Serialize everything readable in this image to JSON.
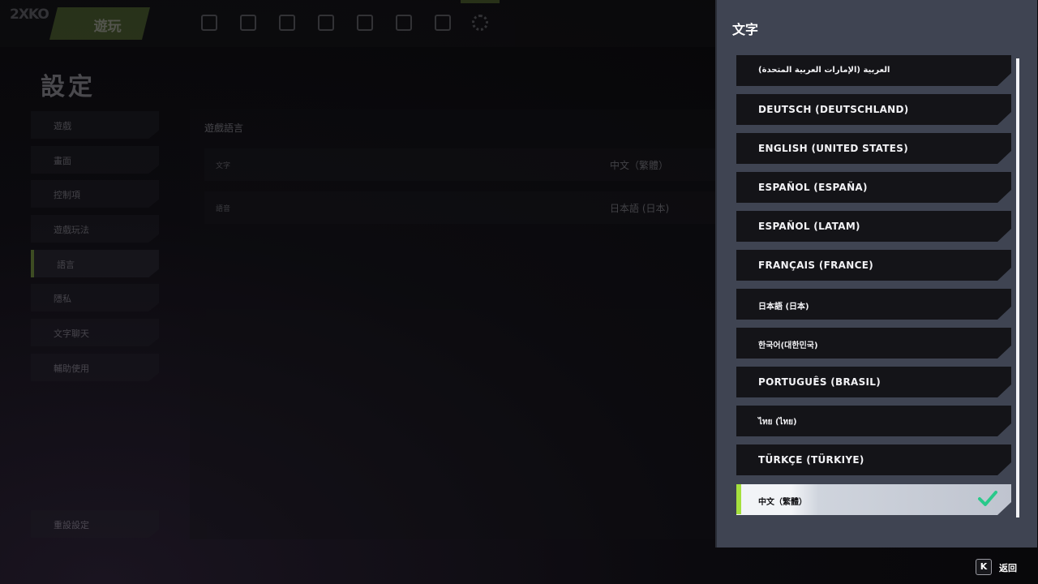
{
  "topbar": {
    "logo": "2XKO",
    "play_tab": "遊玩",
    "icons": [
      "store-icon",
      "bag-icon",
      "mail-icon",
      "collection-icon",
      "social-icon",
      "trophy-icon",
      "profile-icon",
      "calendar-icon",
      "gear-icon"
    ]
  },
  "settings_page": {
    "title": "設定",
    "sidebar": [
      {
        "label": "遊戲",
        "selected": false
      },
      {
        "label": "畫面",
        "selected": false
      },
      {
        "label": "控制項",
        "selected": false
      },
      {
        "label": "遊戲玩法",
        "selected": false
      },
      {
        "label": "語言",
        "selected": true
      },
      {
        "label": "隱私",
        "selected": false
      },
      {
        "label": "文字聊天",
        "selected": false
      },
      {
        "label": "輔助使用",
        "selected": false
      }
    ],
    "reset_button": "重設設定",
    "section_heading": "遊戲語言",
    "rows": [
      {
        "label": "文字",
        "value": "中文（繁體）"
      },
      {
        "label": "語音",
        "value": "日本語 (日本)"
      }
    ]
  },
  "language_panel": {
    "title": "文字",
    "items": [
      {
        "label": "العربية (الإمارات العربية المتحدة)",
        "selected": false
      },
      {
        "label": "DEUTSCH (DEUTSCHLAND)",
        "selected": false
      },
      {
        "label": "ENGLISH (UNITED STATES)",
        "selected": false
      },
      {
        "label": "ESPAÑOL (ESPAÑA)",
        "selected": false
      },
      {
        "label": "ESPAÑOL (LATAM)",
        "selected": false
      },
      {
        "label": "FRANÇAIS (FRANCE)",
        "selected": false
      },
      {
        "label": "日本語 (日本)",
        "selected": false
      },
      {
        "label": "한국어(대한민국)",
        "selected": false
      },
      {
        "label": "PORTUGUÊS (BRASIL)",
        "selected": false
      },
      {
        "label": "ไทย (ไทย)",
        "selected": false
      },
      {
        "label": "TÜRKÇE (TÜRKIYE)",
        "selected": false
      },
      {
        "label": "中文（繁體）",
        "selected": true
      }
    ],
    "check_icon": "check-icon",
    "accent_color": "#a5e03e",
    "check_color": "#29c98a"
  },
  "footer": {
    "back_key": "K",
    "back_label": "返回"
  }
}
